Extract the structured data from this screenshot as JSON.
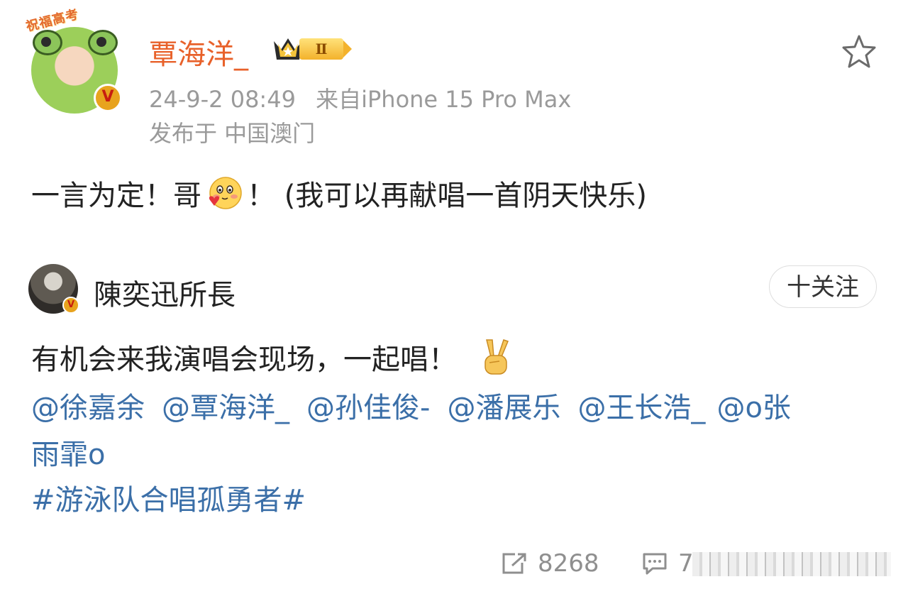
{
  "post": {
    "avatar_pendant": "祝福高考",
    "username": "覃海洋_",
    "vip_level": "Ⅱ",
    "timestamp": "24-9-2 08:49",
    "source": "来自iPhone 15 Pro Max",
    "location": "发布于 中国澳门",
    "text_before_emoji": "一言为定！哥",
    "text_after_emoji": "！ (我可以再献唱一首阴天快乐)",
    "icons": {
      "favorite": "star-outline-icon",
      "emoji": "blush-emoji-icon"
    }
  },
  "quoted": {
    "username": "陳奕迅所長",
    "follow_label": "十关注",
    "text": "有机会来我演唱会现场，一起唱！",
    "mentions_line1": [
      "@徐嘉余",
      "@覃海洋_",
      "@孙佳俊-",
      "@潘展乐",
      "@王长浩_",
      "@o张"
    ],
    "mentions_line2": "雨霏o",
    "hashtag": "#游泳队合唱孤勇者#",
    "icons": {
      "victory": "victory-hand-emoji"
    }
  },
  "footer": {
    "repost_count": "8268",
    "comment_count": "7",
    "icons": {
      "repost": "share-icon",
      "comment": "comment-icon"
    }
  },
  "colors": {
    "username": "#e8612a",
    "link": "#3b6fa8",
    "meta": "#9a9a9a",
    "text": "#222222"
  }
}
